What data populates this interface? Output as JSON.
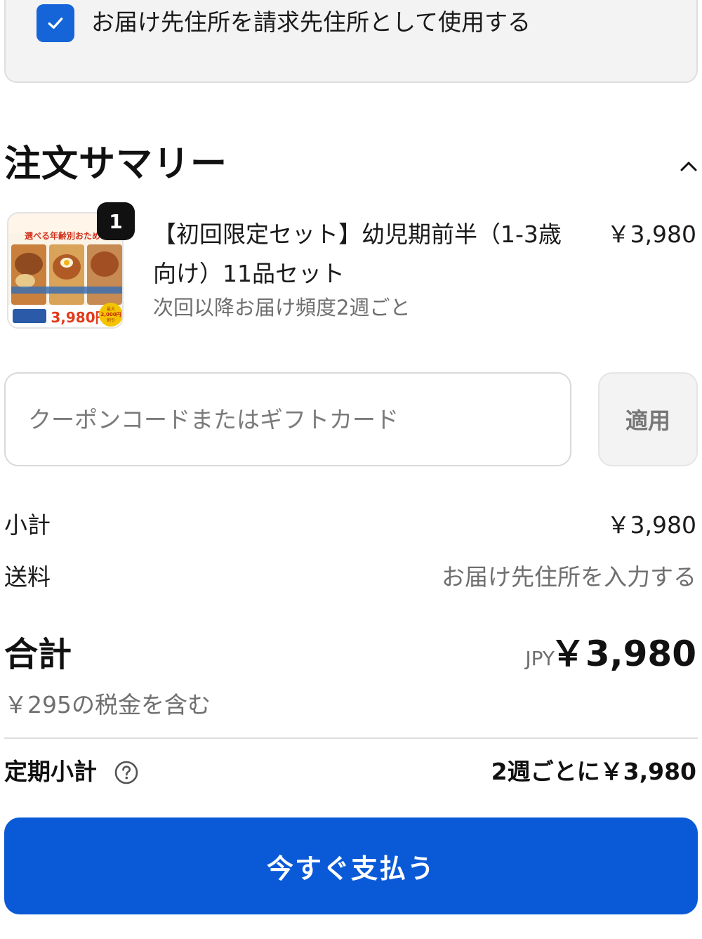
{
  "billing": {
    "checked": true,
    "label": "お届け先住所を請求先住所として使用する"
  },
  "summary": {
    "title": "注文サマリー",
    "toggle_icon": "chevron-up-icon"
  },
  "product": {
    "quantity": "1",
    "name": "【初回限定セット】幼児期前半（1-3歳向け）11品セット",
    "price": "￥3,980",
    "subscription": "次回以降お届け頻度2週ごと",
    "image_text": {
      "heading": "選べる年齢別おためし",
      "price": "3,980円",
      "badge_line1": "最大",
      "badge_line2": "2,000円",
      "badge_line3": "割引"
    }
  },
  "coupon": {
    "placeholder": "クーポンコードまたはギフトカード",
    "apply_label": "適用"
  },
  "subtotal": {
    "label": "小計",
    "value": "￥3,980"
  },
  "shipping": {
    "label": "送料",
    "value": "お届け先住所を入力する"
  },
  "total": {
    "label": "合計",
    "currency": "JPY",
    "value": "￥3,980",
    "tax_note": "￥295の税金を含む"
  },
  "recurring": {
    "label": "定期小計",
    "value": "2週ごとに￥3,980"
  },
  "pay_button": {
    "label": "今すぐ支払う"
  },
  "colors": {
    "accent": "#0a5ad8",
    "checkbox": "#1565d8"
  }
}
